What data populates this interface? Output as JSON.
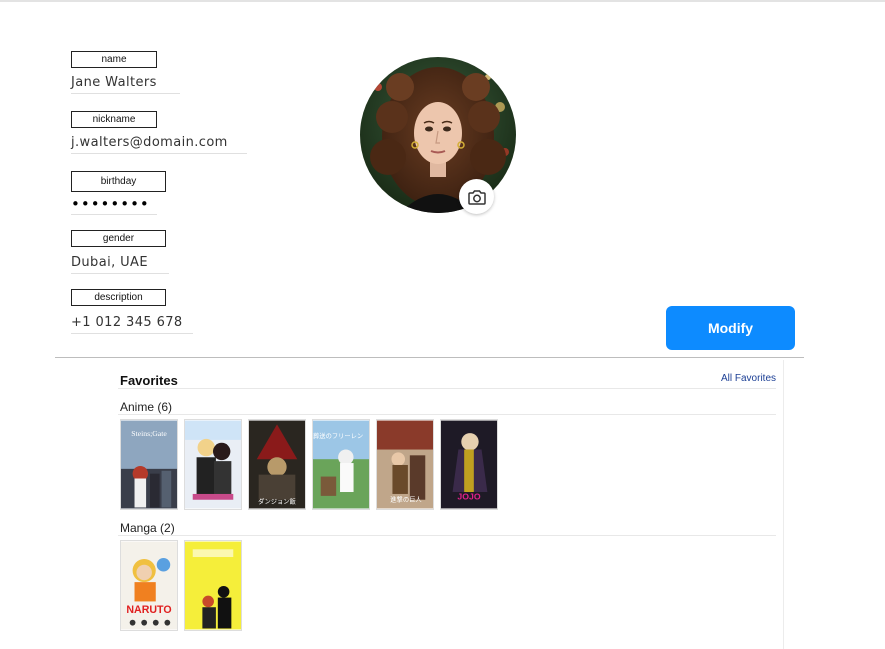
{
  "profile": {
    "fields": [
      {
        "label": "name",
        "value": "Jane Walters"
      },
      {
        "label": "nickname",
        "value": "j.walters@domain.com"
      },
      {
        "label": "birthday",
        "value": "••••••••"
      },
      {
        "label": "gender",
        "value": "Dubai, UAE"
      },
      {
        "label": "description",
        "value": "+1 012 345 678"
      }
    ],
    "modify_label": "Modify",
    "camera_icon": "camera-icon"
  },
  "favorites": {
    "title": "Favorites",
    "all_link": "All Favorites",
    "categories": [
      {
        "title": "Anime (6)",
        "items": [
          {
            "name": "Steins;Gate",
            "caption": "Steins;Gate"
          },
          {
            "name": "Anime cover 2",
            "caption": ""
          },
          {
            "name": "Anime cover 3",
            "caption": "ダンジョン飯"
          },
          {
            "name": "Anime cover 4",
            "caption": "葬送のフリーレン"
          },
          {
            "name": "Anime cover 5",
            "caption": "進撃の巨人"
          },
          {
            "name": "JoJo's Bizarre Adventure",
            "caption": "JOJO"
          }
        ]
      },
      {
        "title": "Manga (2)",
        "items": [
          {
            "name": "Naruto",
            "caption": "NARUTO"
          },
          {
            "name": "Manga cover 2",
            "caption": ""
          }
        ]
      }
    ]
  },
  "colors": {
    "accent": "#0d8bff",
    "link": "#1c3f95"
  }
}
